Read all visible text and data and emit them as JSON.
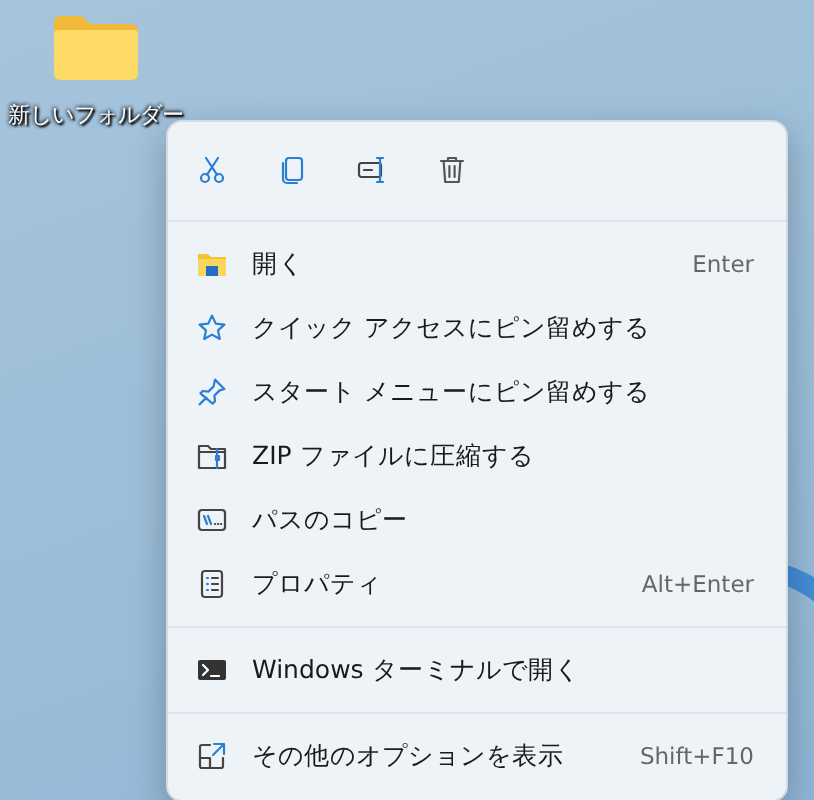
{
  "desktop_icon": {
    "label": "新しいフォルダー"
  },
  "menu": {
    "sections": [
      [
        {
          "label": "開く",
          "shortcut": "Enter"
        },
        {
          "label": "クイック アクセスにピン留めする"
        },
        {
          "label": "スタート メニューにピン留めする"
        },
        {
          "label": "ZIP ファイルに圧縮する"
        },
        {
          "label": "パスのコピー"
        },
        {
          "label": "プロパティ",
          "shortcut": "Alt+Enter"
        }
      ],
      [
        {
          "label": "Windows ターミナルで開く"
        }
      ],
      [
        {
          "label": "その他のオプションを表示",
          "shortcut": "Shift+F10"
        }
      ]
    ]
  }
}
